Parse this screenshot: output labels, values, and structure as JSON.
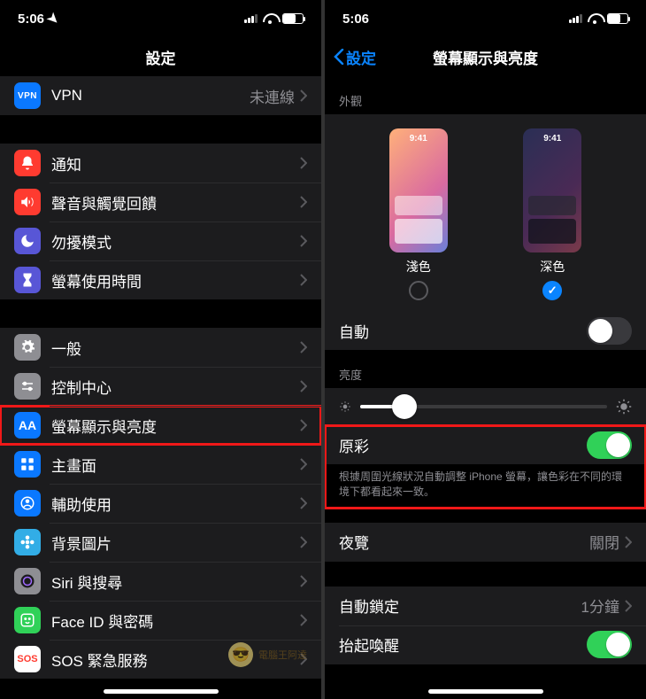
{
  "left": {
    "status_time": "5:06",
    "title": "設定",
    "vpn": {
      "label": "VPN",
      "detail": "未連線"
    },
    "group1": [
      {
        "key": "notif",
        "label": "通知",
        "icon_bg": "bg-red",
        "icon": "bell"
      },
      {
        "key": "sound",
        "label": "聲音與觸覺回饋",
        "icon_bg": "bg-red",
        "icon": "speaker"
      },
      {
        "key": "dnd",
        "label": "勿擾模式",
        "icon_bg": "bg-purple",
        "icon": "moon"
      },
      {
        "key": "screentime",
        "label": "螢幕使用時間",
        "icon_bg": "bg-purple",
        "icon": "hourglass"
      }
    ],
    "group2": [
      {
        "key": "general",
        "label": "一般",
        "icon_bg": "bg-gray",
        "icon": "gear",
        "highlight": false
      },
      {
        "key": "control",
        "label": "控制中心",
        "icon_bg": "bg-gray",
        "icon": "switches",
        "highlight": false
      },
      {
        "key": "display",
        "label": "螢幕顯示與亮度",
        "icon_bg": "bg-blue",
        "icon": "aa",
        "highlight": true
      },
      {
        "key": "home",
        "label": "主畫面",
        "icon_bg": "bg-blue",
        "icon": "grid",
        "highlight": false
      },
      {
        "key": "access",
        "label": "輔助使用",
        "icon_bg": "bg-blue",
        "icon": "person",
        "highlight": false
      },
      {
        "key": "wall",
        "label": "背景圖片",
        "icon_bg": "bg-cyan",
        "icon": "flower",
        "highlight": false
      },
      {
        "key": "siri",
        "label": "Siri 與搜尋",
        "icon_bg": "bg-gray",
        "icon": "siri",
        "highlight": false
      },
      {
        "key": "faceid",
        "label": "Face ID 與密碼",
        "icon_bg": "bg-green",
        "icon": "face",
        "highlight": false
      },
      {
        "key": "sos",
        "label": "SOS 緊急服務",
        "icon_bg": "bg-sos",
        "icon": "sos",
        "highlight": false
      }
    ],
    "watermark": "電腦王阿達"
  },
  "right": {
    "status_time": "5:06",
    "back": "設定",
    "title": "螢幕顯示與亮度",
    "appearance_header": "外觀",
    "light_label": "淺色",
    "dark_label": "深色",
    "preview_time": "9:41",
    "selected": "dark",
    "auto": {
      "label": "自動",
      "on": false
    },
    "brightness_header": "亮度",
    "brightness_value": 18,
    "truetone": {
      "label": "原彩",
      "on": true,
      "desc": "根據周圍光線狀況自動調整 iPhone 螢幕，讓色彩在不同的環境下都看起來一致。"
    },
    "night_shift": {
      "label": "夜覽",
      "detail": "關閉"
    },
    "auto_lock": {
      "label": "自動鎖定",
      "detail": "1分鐘"
    },
    "raise": {
      "label": "抬起喚醒",
      "on": true
    }
  }
}
